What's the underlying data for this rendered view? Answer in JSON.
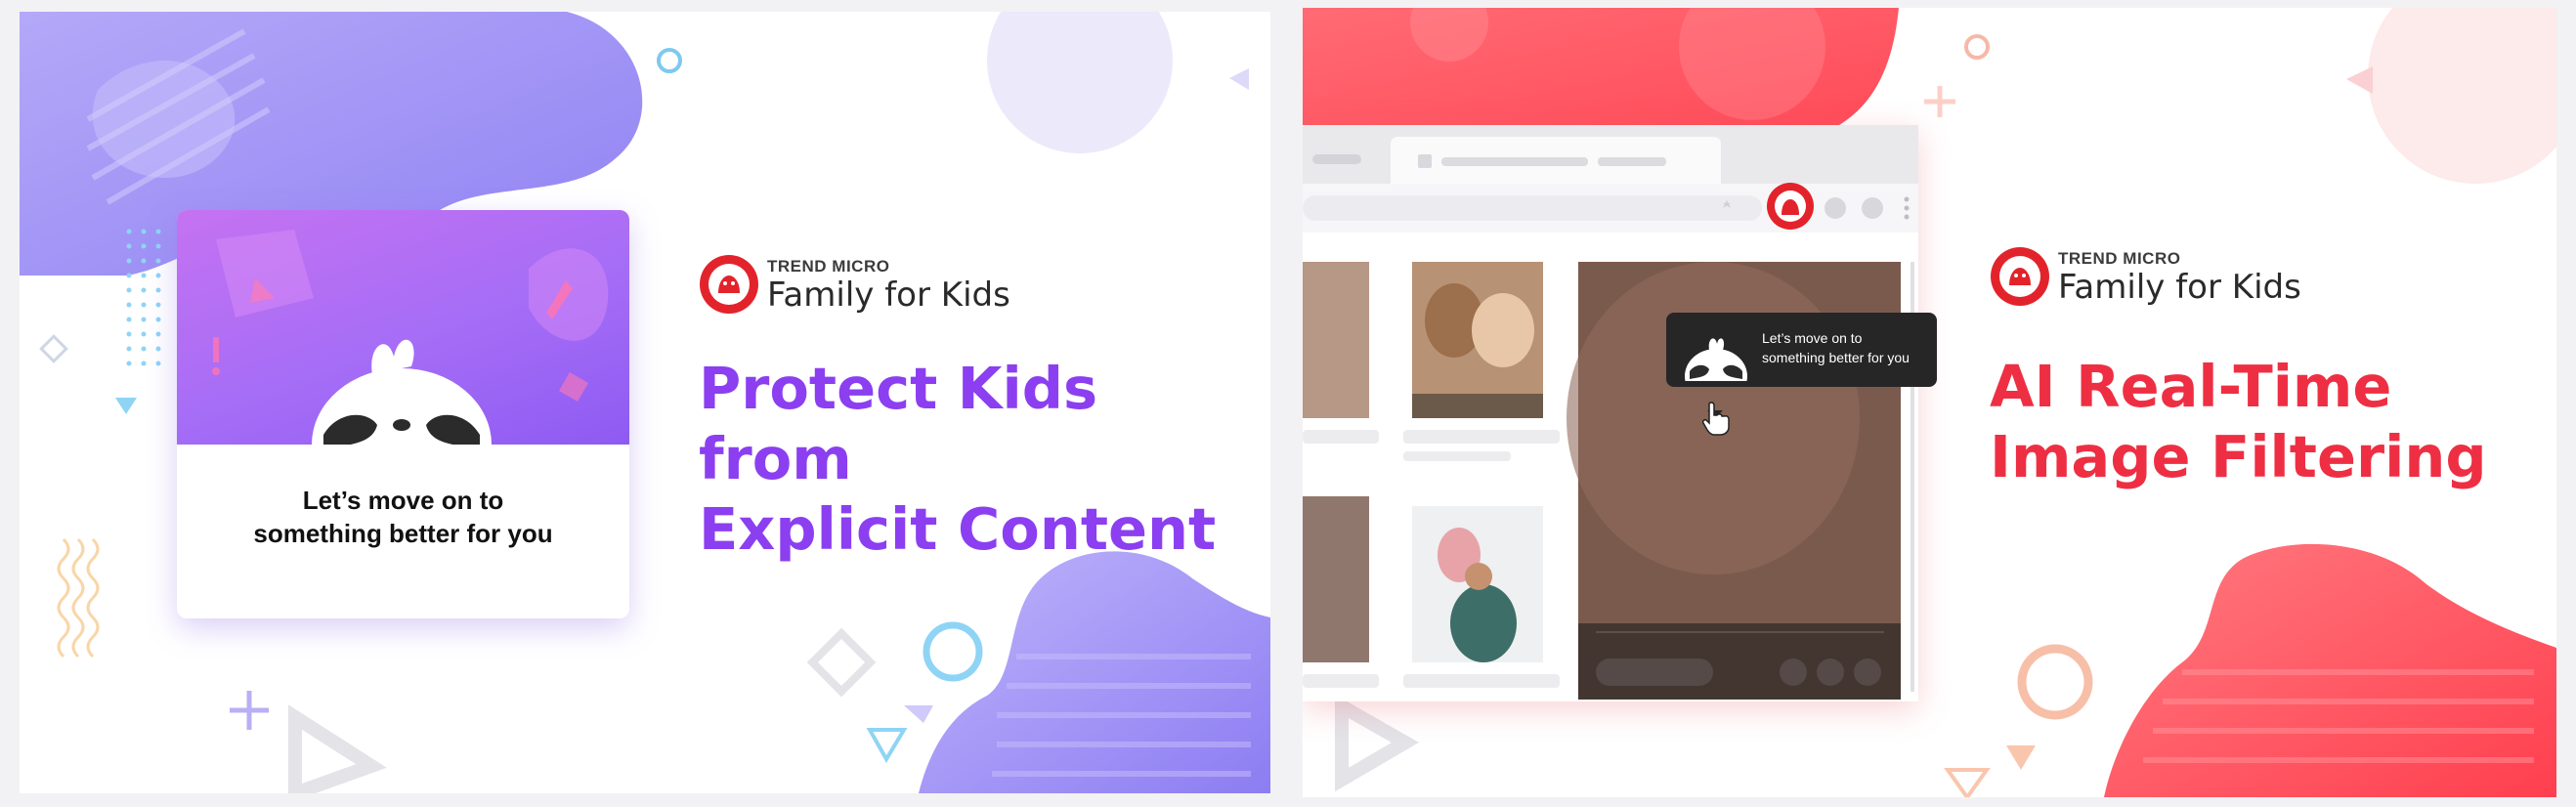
{
  "panels": [
    {
      "brand": {
        "company": "TREND MICRO",
        "product": "Family for Kids"
      },
      "headline": [
        "Protect Kids from",
        "Explicit Content"
      ],
      "card": {
        "message_line1": "Let’s move on to",
        "message_line2": "something better for you"
      }
    },
    {
      "brand": {
        "company": "TREND MICRO",
        "product": "Family for Kids"
      },
      "headline": [
        "AI Real-Time",
        "Image Filtering"
      ],
      "tooltip": {
        "line1": "Let’s move on to",
        "line2": "something better for you"
      }
    }
  ],
  "colors": {
    "purple": "#8b3ff0",
    "red": "#ee2f43",
    "lavender": "#a99af7",
    "coral": "#ff5a68"
  },
  "icons": [
    "trend-micro-logo-icon",
    "sloth-mascot-icon",
    "cursor-hand-icon",
    "star-icon",
    "home-icon",
    "more-icon"
  ]
}
